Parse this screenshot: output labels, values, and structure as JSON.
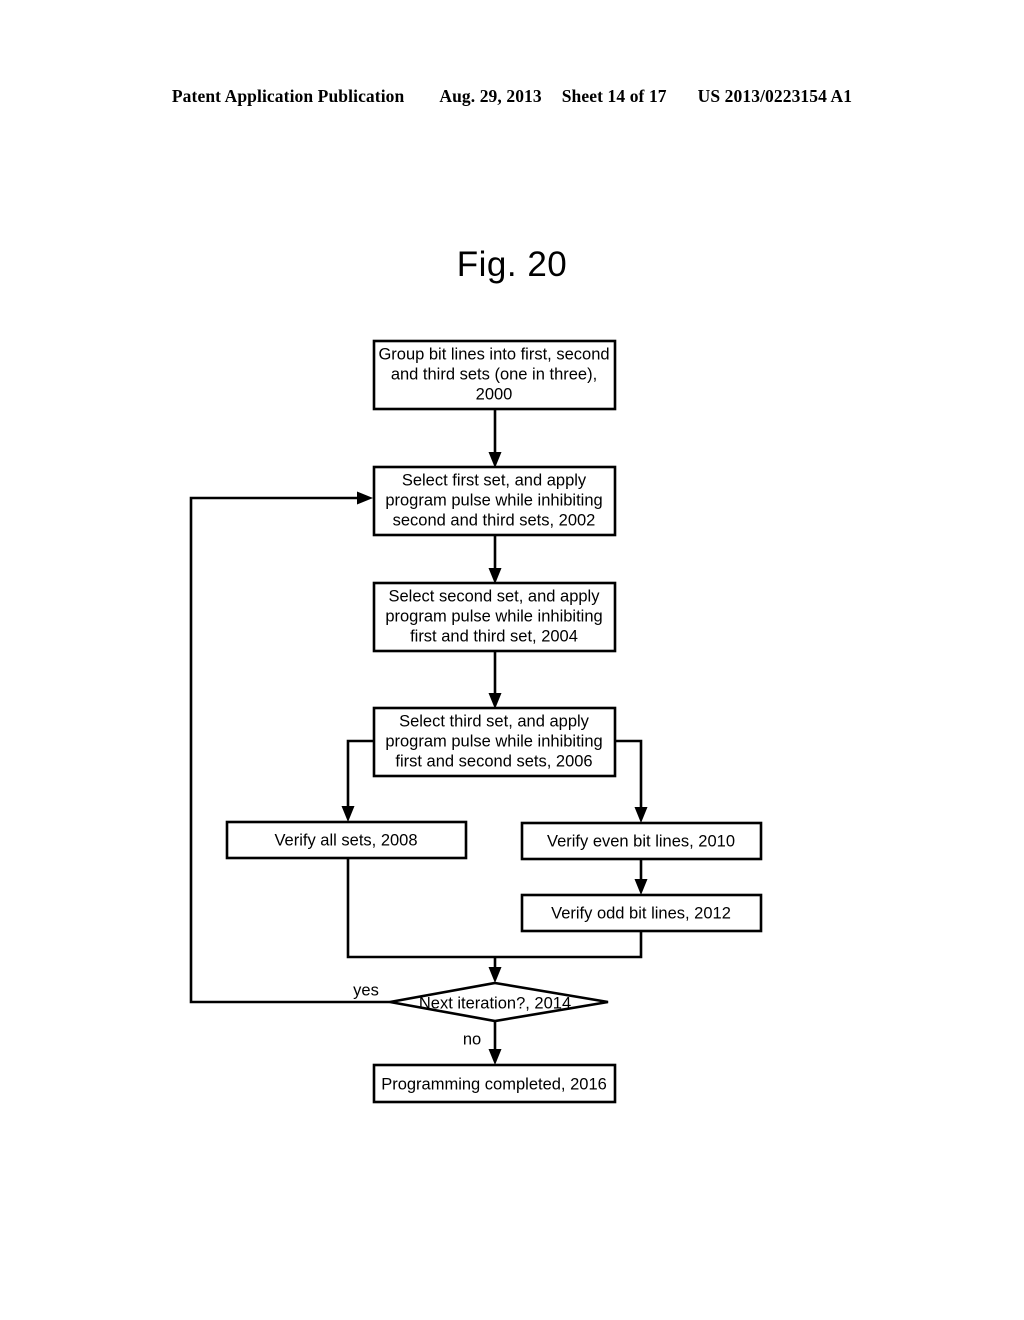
{
  "header": {
    "publication": "Patent Application Publication",
    "date": "Aug. 29, 2013",
    "sheet": "Sheet 14 of 17",
    "patent_number": "US 2013/0223154 A1"
  },
  "figure": {
    "title": "Fig. 20"
  },
  "flowchart": {
    "nodes": {
      "n2000": {
        "id": "2000",
        "line1": "Group bit lines into first, second",
        "line2": "and third sets (one in three),",
        "line3": "2000"
      },
      "n2002": {
        "id": "2002",
        "line1": "Select first set, and apply",
        "line2": "program pulse while inhibiting",
        "line3": "second and third sets, 2002"
      },
      "n2004": {
        "id": "2004",
        "line1": "Select second set, and apply",
        "line2": "program pulse while inhibiting",
        "line3": "first and third set, 2004"
      },
      "n2006": {
        "id": "2006",
        "line1": "Select third set, and apply",
        "line2": "program pulse while inhibiting",
        "line3": "first and second sets, 2006"
      },
      "n2008": {
        "id": "2008",
        "line1": "Verify all sets, 2008"
      },
      "n2010": {
        "id": "2010",
        "line1": "Verify even bit lines, 2010"
      },
      "n2012": {
        "id": "2012",
        "line1": "Verify odd bit lines, 2012"
      },
      "n2014": {
        "id": "2014",
        "line1": "Next iteration?, 2014"
      },
      "n2016": {
        "id": "2016",
        "line1": "Programming completed, 2016"
      }
    },
    "edge_labels": {
      "yes": "yes",
      "no": "no"
    },
    "colors": {
      "stroke": "#000000",
      "fill": "#ffffff",
      "text": "#000000"
    }
  }
}
